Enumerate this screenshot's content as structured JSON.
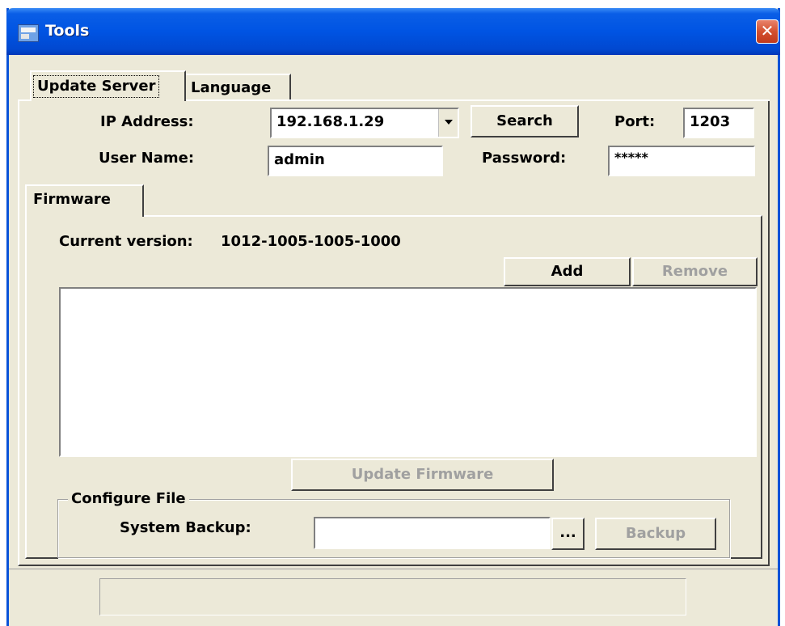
{
  "window": {
    "title": "Tools",
    "close_glyph": "✕",
    "icon": "app-window-icon",
    "accent": "#0054e3"
  },
  "tabs": [
    {
      "label": "Update Server",
      "active": true
    },
    {
      "label": "Language",
      "active": false
    }
  ],
  "server": {
    "ip_label": "IP Address:",
    "ip_value": "192.168.1.29",
    "search_label": "Search",
    "port_label": "Port:",
    "port_value": "1203",
    "user_label": "User Name:",
    "user_value": "admin",
    "password_label": "Password:",
    "password_value": "*****"
  },
  "firmware": {
    "tab_label": "Firmware",
    "current_version_label": "Current version:",
    "current_version_value": "1012-1005-1005-1000",
    "add_label": "Add",
    "remove_label": "Remove",
    "files": [],
    "update_label": "Update Firmware"
  },
  "configure": {
    "group_label": "Configure File",
    "backup_label": "System Backup:",
    "backup_path": "",
    "browse_label": "...",
    "backup_button_label": "Backup"
  },
  "status": {
    "text": ""
  }
}
